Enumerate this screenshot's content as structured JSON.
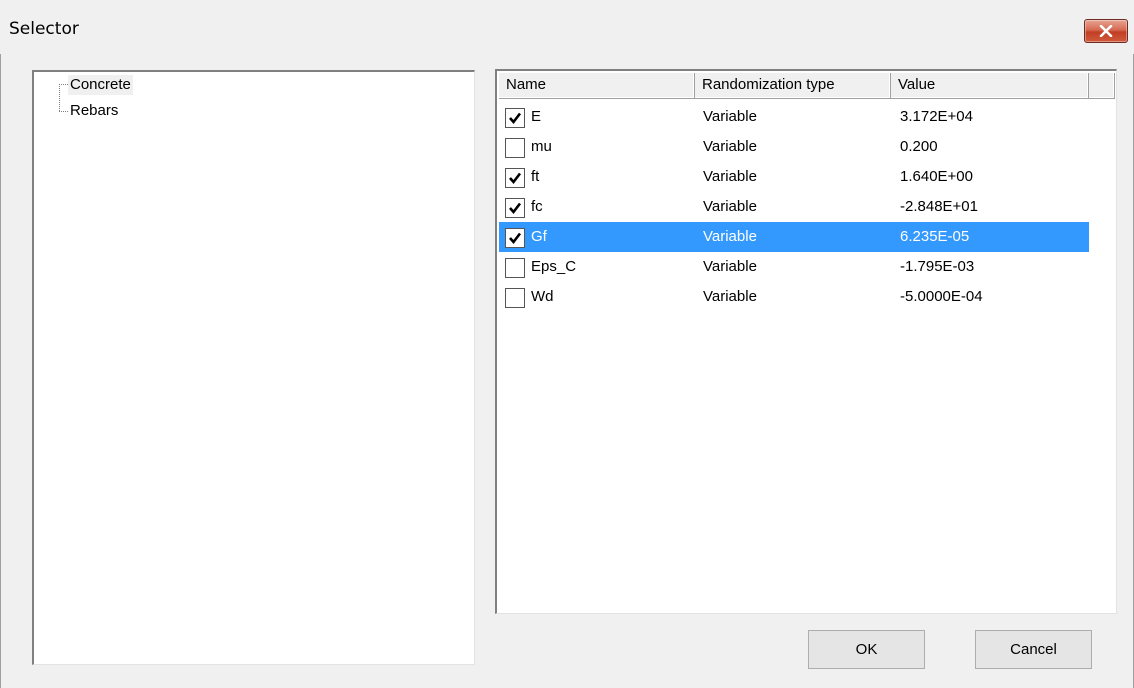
{
  "window": {
    "title": "Selector",
    "close_icon": "close-icon"
  },
  "tree": {
    "items": [
      {
        "label": "Concrete",
        "selected": true
      },
      {
        "label": "Rebars",
        "selected": false
      }
    ]
  },
  "list": {
    "columns": [
      "Name",
      "Randomization type",
      "Value"
    ],
    "rows": [
      {
        "checked": true,
        "name": "E",
        "type": "Variable",
        "value": "3.172E+04",
        "selected": false
      },
      {
        "checked": false,
        "name": "mu",
        "type": "Variable",
        "value": "0.200",
        "selected": false
      },
      {
        "checked": true,
        "name": "ft",
        "type": "Variable",
        "value": "1.640E+00",
        "selected": false
      },
      {
        "checked": true,
        "name": "fc",
        "type": "Variable",
        "value": "-2.848E+01",
        "selected": false
      },
      {
        "checked": true,
        "name": "Gf",
        "type": "Variable",
        "value": "6.235E-05",
        "selected": true
      },
      {
        "checked": false,
        "name": "Eps_C",
        "type": "Variable",
        "value": "-1.795E-03",
        "selected": false
      },
      {
        "checked": false,
        "name": "Wd",
        "type": "Variable",
        "value": "-5.0000E-04",
        "selected": false
      }
    ]
  },
  "buttons": {
    "ok": "OK",
    "cancel": "Cancel"
  },
  "colors": {
    "selection": "#3399ff",
    "close_button": "#c23e24"
  }
}
